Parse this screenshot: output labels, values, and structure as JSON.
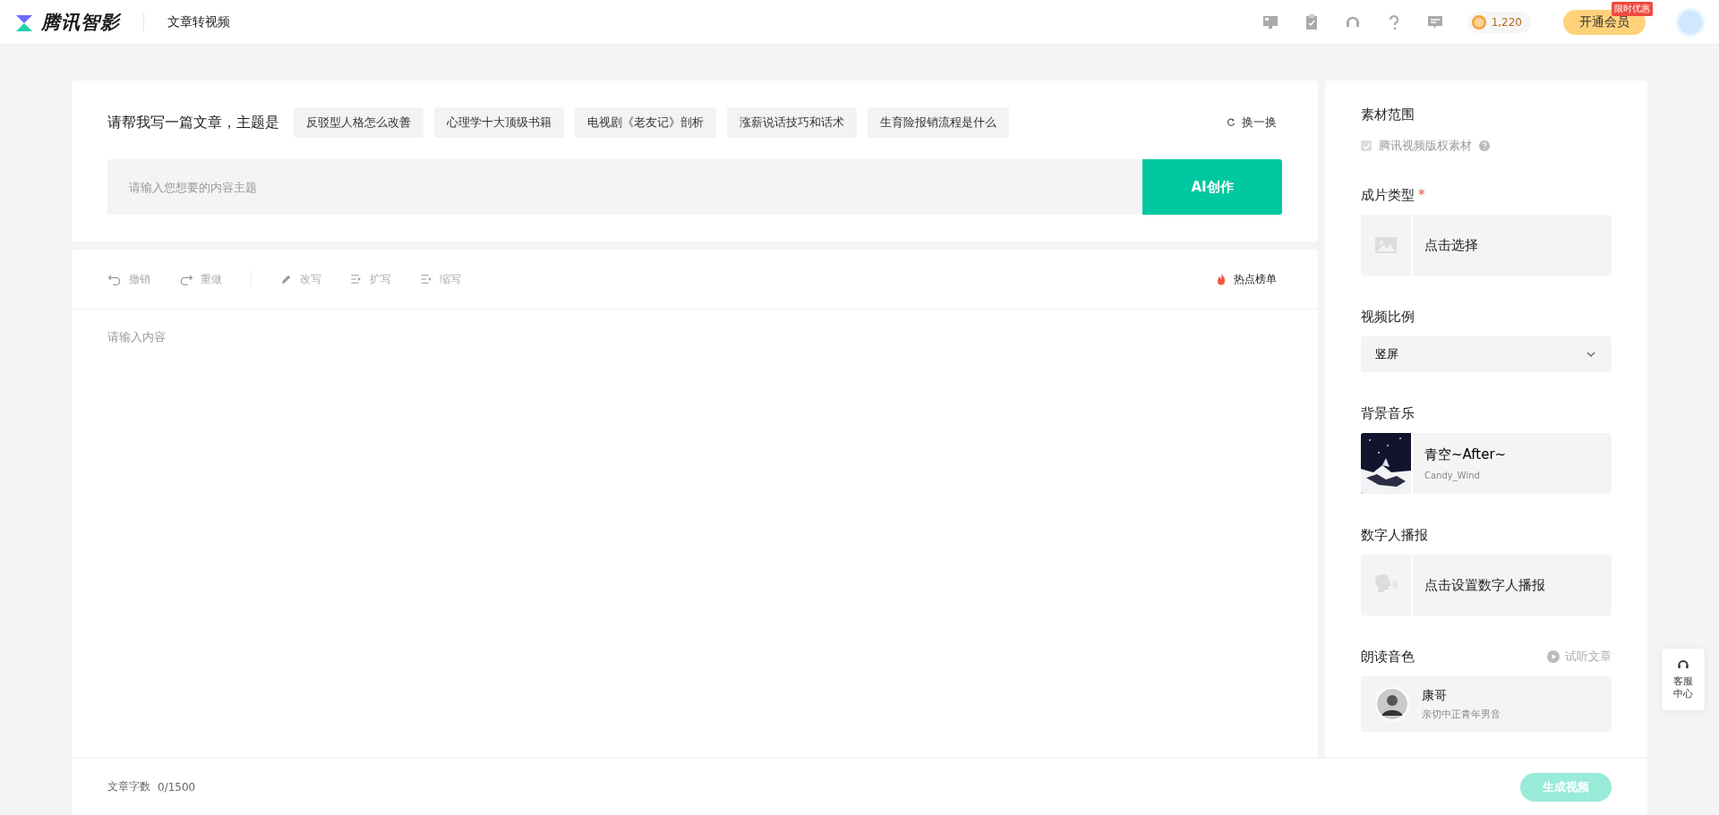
{
  "header": {
    "brand": "腾讯智影",
    "page_title": "文章转视频",
    "coins": "1,220",
    "vip_button": "开通会员",
    "vip_badge": "限时优惠"
  },
  "prompt": {
    "lead": "请帮我写一篇文章，主题是",
    "topics": [
      "反驳型人格怎么改善",
      "心理学十大顶级书籍",
      "电视剧《老友记》剖析",
      "涨薪说话技巧和话术",
      "生育险报销流程是什么"
    ],
    "refresh": "换一换",
    "placeholder": "请输入您想要的内容主题",
    "submit": "AI创作"
  },
  "toolbar": {
    "tools": [
      {
        "kind": "undo",
        "label": "撤销",
        "disabled": true
      },
      {
        "kind": "redo",
        "label": "重做",
        "disabled": true
      },
      {
        "kind": "rewrite",
        "label": "改写",
        "disabled": true
      },
      {
        "kind": "expand",
        "label": "扩写",
        "disabled": true
      },
      {
        "kind": "shrink",
        "label": "缩写",
        "disabled": true
      }
    ],
    "hot": "热点榜单"
  },
  "editor": {
    "placeholder": "请输入内容"
  },
  "footer": {
    "count_label": "文章字数",
    "count": "0/1500",
    "generate": "生成视频",
    "generate_disabled": true
  },
  "settings": {
    "material": {
      "title": "素材范围",
      "option": "腾讯视频版权素材",
      "checked": true,
      "disabled": true
    },
    "type": {
      "title": "成片类型",
      "required": "*",
      "action": "点击选择"
    },
    "ratio": {
      "title": "视频比例",
      "value": "竖屏"
    },
    "music": {
      "title": "背景音乐",
      "kind": "picture",
      "name": "青空~After~",
      "artist": "Candy_Wind"
    },
    "avatar": {
      "title": "数字人播报",
      "action": "点击设置数字人播报"
    },
    "voice": {
      "title": "朗读音色",
      "preview": "试听文章",
      "name": "康哥",
      "desc": "亲切中正青年男音"
    }
  },
  "float": {
    "label": "客服中心"
  }
}
